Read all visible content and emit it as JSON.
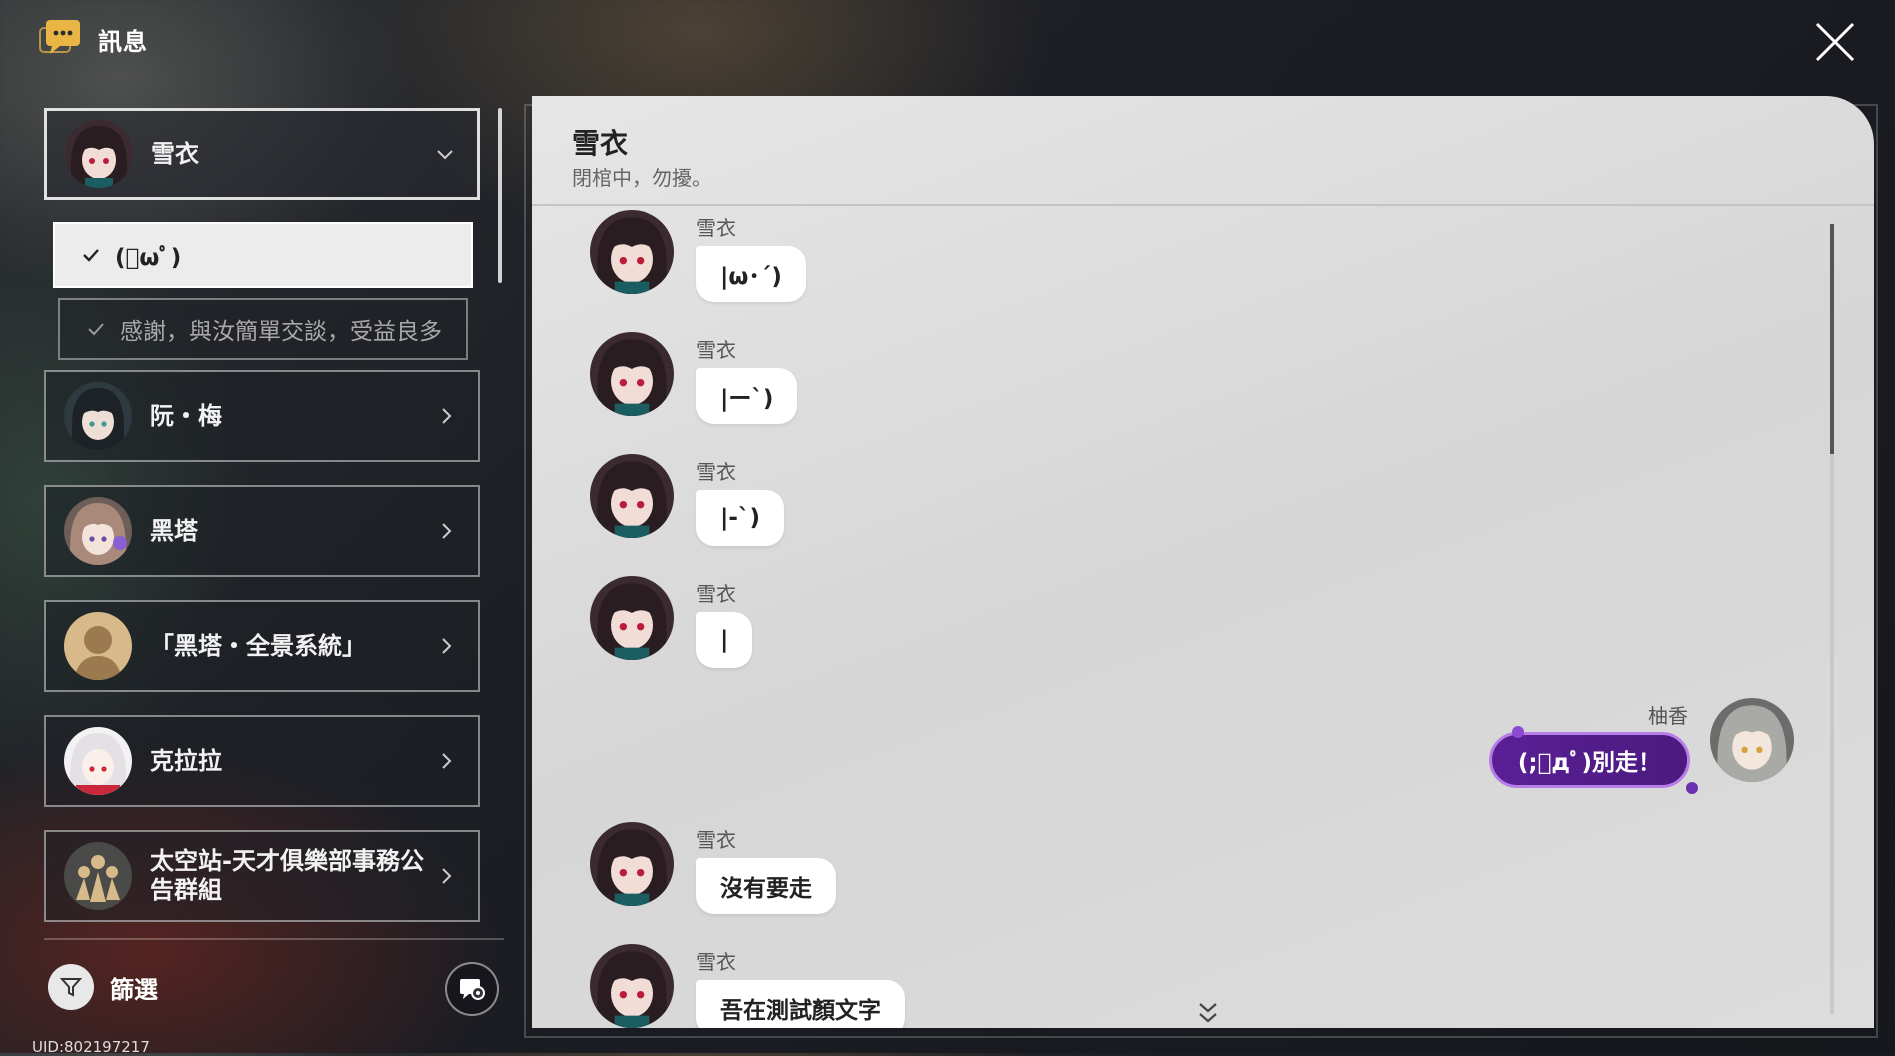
{
  "header": {
    "title": "訊息"
  },
  "contacts": [
    {
      "name": "雪衣",
      "active": true,
      "avatar": "xueyi"
    },
    {
      "name": "阮・梅",
      "avatar": "ruanmei"
    },
    {
      "name": "黑塔",
      "avatar": "herta"
    },
    {
      "name": "「黑塔・全景系統」",
      "avatar": "placeholder"
    },
    {
      "name": "克拉拉",
      "avatar": "clara"
    },
    {
      "name": "太空站-天才俱樂部事務公告群組",
      "avatar": "group"
    }
  ],
  "sub_items": [
    {
      "label": "(ﾟωﾟ)",
      "selected": true
    },
    {
      "label": "感謝，與汝簡單交談，受益良多",
      "selected": false
    }
  ],
  "footer": {
    "filter_label": "篩選",
    "uid": "UID:802197217"
  },
  "chat": {
    "title": "雪衣",
    "subtitle": "閉棺中，勿擾。",
    "messages": [
      {
        "sender": "雪衣",
        "text": "|ω･´)"
      },
      {
        "sender": "雪衣",
        "text": "|ー`)"
      },
      {
        "sender": "雪衣",
        "text": "|-`)"
      },
      {
        "sender": "雪衣",
        "text": "|"
      },
      {
        "sender": "柚香",
        "text": "(;ﾟдﾟ)別走！",
        "self": true
      },
      {
        "sender": "雪衣",
        "text": "沒有要走"
      },
      {
        "sender": "雪衣",
        "text": "吾在測試顏文字"
      }
    ]
  },
  "colors": {
    "self_bubble": "#5a1f96",
    "self_border": "#b67ee6",
    "panel_bg": "#dedede"
  },
  "icons": {
    "header": "chat-bubble-icon",
    "close": "close-icon",
    "filter": "filter-icon",
    "settings": "chat-settings-icon"
  }
}
